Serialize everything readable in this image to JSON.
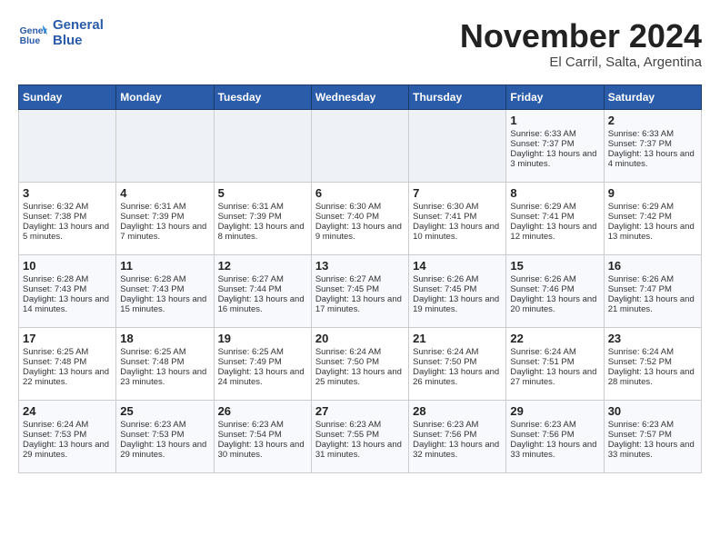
{
  "logo": {
    "line1": "General",
    "line2": "Blue"
  },
  "title": "November 2024",
  "subtitle": "El Carril, Salta, Argentina",
  "days_header": [
    "Sunday",
    "Monday",
    "Tuesday",
    "Wednesday",
    "Thursday",
    "Friday",
    "Saturday"
  ],
  "weeks": [
    [
      {
        "day": "",
        "info": ""
      },
      {
        "day": "",
        "info": ""
      },
      {
        "day": "",
        "info": ""
      },
      {
        "day": "",
        "info": ""
      },
      {
        "day": "",
        "info": ""
      },
      {
        "day": "1",
        "info": "Sunrise: 6:33 AM\nSunset: 7:37 PM\nDaylight: 13 hours and 3 minutes."
      },
      {
        "day": "2",
        "info": "Sunrise: 6:33 AM\nSunset: 7:37 PM\nDaylight: 13 hours and 4 minutes."
      }
    ],
    [
      {
        "day": "3",
        "info": "Sunrise: 6:32 AM\nSunset: 7:38 PM\nDaylight: 13 hours and 5 minutes."
      },
      {
        "day": "4",
        "info": "Sunrise: 6:31 AM\nSunset: 7:39 PM\nDaylight: 13 hours and 7 minutes."
      },
      {
        "day": "5",
        "info": "Sunrise: 6:31 AM\nSunset: 7:39 PM\nDaylight: 13 hours and 8 minutes."
      },
      {
        "day": "6",
        "info": "Sunrise: 6:30 AM\nSunset: 7:40 PM\nDaylight: 13 hours and 9 minutes."
      },
      {
        "day": "7",
        "info": "Sunrise: 6:30 AM\nSunset: 7:41 PM\nDaylight: 13 hours and 10 minutes."
      },
      {
        "day": "8",
        "info": "Sunrise: 6:29 AM\nSunset: 7:41 PM\nDaylight: 13 hours and 12 minutes."
      },
      {
        "day": "9",
        "info": "Sunrise: 6:29 AM\nSunset: 7:42 PM\nDaylight: 13 hours and 13 minutes."
      }
    ],
    [
      {
        "day": "10",
        "info": "Sunrise: 6:28 AM\nSunset: 7:43 PM\nDaylight: 13 hours and 14 minutes."
      },
      {
        "day": "11",
        "info": "Sunrise: 6:28 AM\nSunset: 7:43 PM\nDaylight: 13 hours and 15 minutes."
      },
      {
        "day": "12",
        "info": "Sunrise: 6:27 AM\nSunset: 7:44 PM\nDaylight: 13 hours and 16 minutes."
      },
      {
        "day": "13",
        "info": "Sunrise: 6:27 AM\nSunset: 7:45 PM\nDaylight: 13 hours and 17 minutes."
      },
      {
        "day": "14",
        "info": "Sunrise: 6:26 AM\nSunset: 7:45 PM\nDaylight: 13 hours and 19 minutes."
      },
      {
        "day": "15",
        "info": "Sunrise: 6:26 AM\nSunset: 7:46 PM\nDaylight: 13 hours and 20 minutes."
      },
      {
        "day": "16",
        "info": "Sunrise: 6:26 AM\nSunset: 7:47 PM\nDaylight: 13 hours and 21 minutes."
      }
    ],
    [
      {
        "day": "17",
        "info": "Sunrise: 6:25 AM\nSunset: 7:48 PM\nDaylight: 13 hours and 22 minutes."
      },
      {
        "day": "18",
        "info": "Sunrise: 6:25 AM\nSunset: 7:48 PM\nDaylight: 13 hours and 23 minutes."
      },
      {
        "day": "19",
        "info": "Sunrise: 6:25 AM\nSunset: 7:49 PM\nDaylight: 13 hours and 24 minutes."
      },
      {
        "day": "20",
        "info": "Sunrise: 6:24 AM\nSunset: 7:50 PM\nDaylight: 13 hours and 25 minutes."
      },
      {
        "day": "21",
        "info": "Sunrise: 6:24 AM\nSunset: 7:50 PM\nDaylight: 13 hours and 26 minutes."
      },
      {
        "day": "22",
        "info": "Sunrise: 6:24 AM\nSunset: 7:51 PM\nDaylight: 13 hours and 27 minutes."
      },
      {
        "day": "23",
        "info": "Sunrise: 6:24 AM\nSunset: 7:52 PM\nDaylight: 13 hours and 28 minutes."
      }
    ],
    [
      {
        "day": "24",
        "info": "Sunrise: 6:24 AM\nSunset: 7:53 PM\nDaylight: 13 hours and 29 minutes."
      },
      {
        "day": "25",
        "info": "Sunrise: 6:23 AM\nSunset: 7:53 PM\nDaylight: 13 hours and 29 minutes."
      },
      {
        "day": "26",
        "info": "Sunrise: 6:23 AM\nSunset: 7:54 PM\nDaylight: 13 hours and 30 minutes."
      },
      {
        "day": "27",
        "info": "Sunrise: 6:23 AM\nSunset: 7:55 PM\nDaylight: 13 hours and 31 minutes."
      },
      {
        "day": "28",
        "info": "Sunrise: 6:23 AM\nSunset: 7:56 PM\nDaylight: 13 hours and 32 minutes."
      },
      {
        "day": "29",
        "info": "Sunrise: 6:23 AM\nSunset: 7:56 PM\nDaylight: 13 hours and 33 minutes."
      },
      {
        "day": "30",
        "info": "Sunrise: 6:23 AM\nSunset: 7:57 PM\nDaylight: 13 hours and 33 minutes."
      }
    ]
  ]
}
